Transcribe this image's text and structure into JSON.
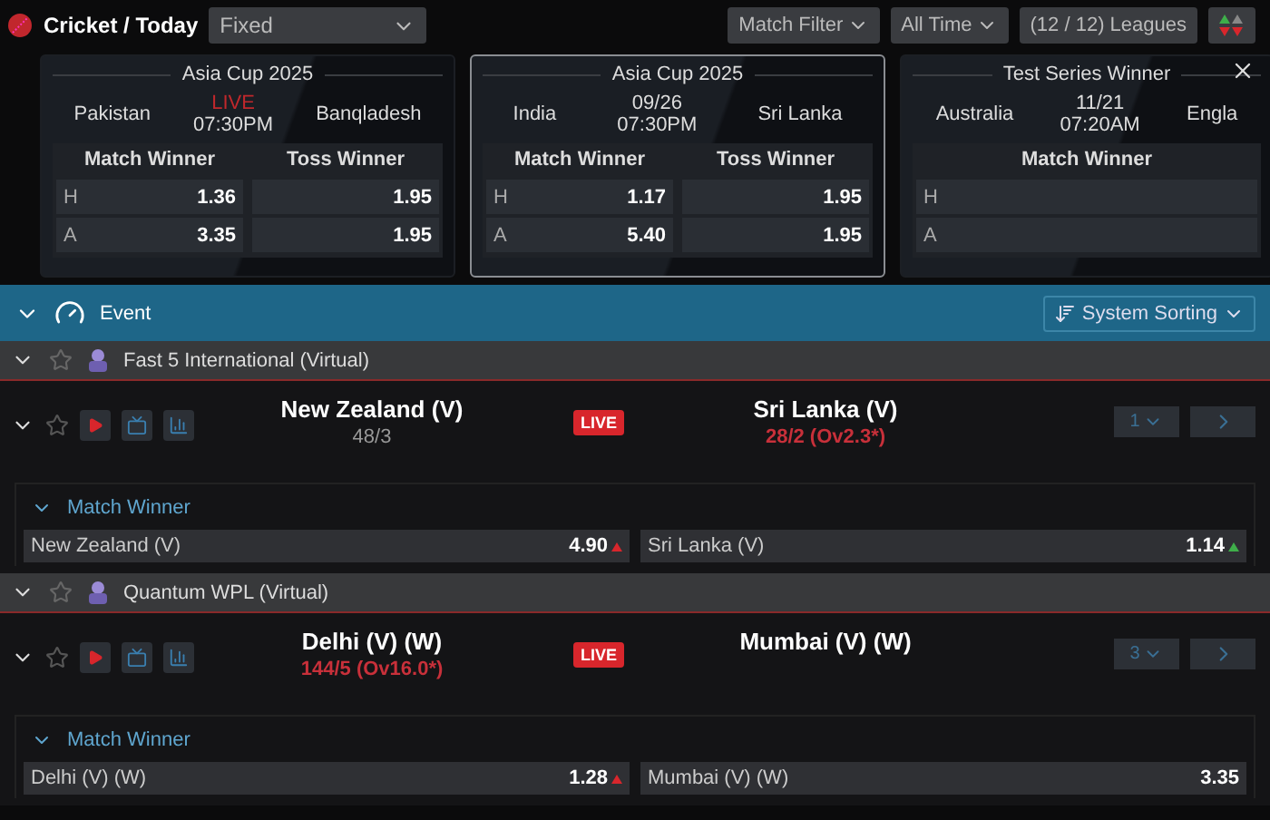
{
  "header": {
    "title": "Cricket / Today",
    "select": "Fixed",
    "filters": [
      "Match Filter",
      "All Time"
    ],
    "leagues": "(12 / 12) Leagues"
  },
  "cards": [
    {
      "title": "Asia Cup 2025",
      "home": "Pakistan",
      "away": "Banqladesh",
      "status": "LIVE",
      "live": true,
      "time": "07:30PM",
      "selected": false,
      "rows": [
        "H",
        "A"
      ],
      "markets": [
        {
          "title": "Match Winner",
          "odds": [
            "1.36",
            "3.35"
          ]
        },
        {
          "title": "Toss Winner",
          "odds": [
            "1.95",
            "1.95"
          ]
        }
      ]
    },
    {
      "title": "Asia Cup 2025",
      "home": "India",
      "away": "Sri Lanka",
      "status": "09/26",
      "live": false,
      "time": "07:30PM",
      "selected": true,
      "rows": [
        "H",
        "A"
      ],
      "markets": [
        {
          "title": "Match Winner",
          "odds": [
            "1.17",
            "5.40"
          ]
        },
        {
          "title": "Toss Winner",
          "odds": [
            "1.95",
            "1.95"
          ]
        }
      ]
    },
    {
      "title": "Test Series Winner",
      "home": "Australia",
      "away": "Engla",
      "status": "11/21",
      "live": false,
      "time": "07:20AM",
      "selected": false,
      "rows": [
        "H",
        "A"
      ],
      "markets": [
        {
          "title": "Match Winner"
        }
      ]
    }
  ],
  "event_bar": {
    "title": "Event",
    "sorting": "System Sorting"
  },
  "leagues": [
    {
      "name": "Fast 5 International (Virtual)",
      "expanded": true,
      "match": {
        "home": {
          "name": "New Zealand (V)",
          "score": "48/3",
          "batting": false
        },
        "away": {
          "name": "Sri Lanka (V)",
          "score": "28/2 (Ov2.3*)",
          "batting": true
        },
        "live": "LIVE",
        "more": "1",
        "market": {
          "title": "Match Winner",
          "expanded": true,
          "outcomes": [
            {
              "name": "New Zealand (V)",
              "odds": "4.90",
              "color": "#d8262c"
            },
            {
              "name": "Sri Lanka (V)",
              "odds": "1.14",
              "color": "#3fae4a"
            }
          ]
        }
      }
    },
    {
      "name": "Quantum WPL (Virtual)",
      "expanded": true,
      "match": {
        "home": {
          "name": "Delhi (V) (W)",
          "score": "144/5 (Ov16.0*)",
          "batting": true
        },
        "away": {
          "name": "Mumbai (V) (W)"
        },
        "live": "LIVE",
        "more": "3",
        "market": {
          "title": "Match Winner",
          "expanded": true,
          "outcomes": [
            {
              "name": "Delhi (V) (W)",
              "odds": "1.28",
              "color": "#d8262c"
            },
            {
              "name": "Mumbai (V) (W)",
              "odds": "3.35"
            }
          ]
        }
      }
    }
  ]
}
